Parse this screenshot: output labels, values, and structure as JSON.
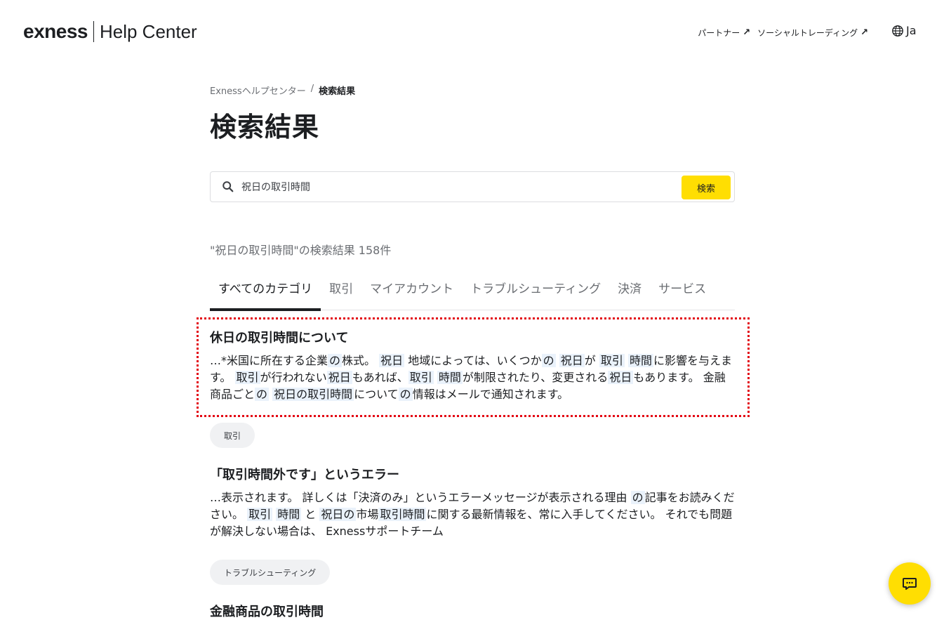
{
  "header": {
    "logo_text": "exness",
    "logo_subtitle": "Help Center",
    "links": [
      {
        "label": "パートナー",
        "icon": "external-arrow-icon"
      },
      {
        "label": "ソーシャルトレーディング",
        "icon": "external-arrow-icon"
      }
    ],
    "language": "Ja"
  },
  "breadcrumb": {
    "home": "Exnessヘルプセンター",
    "separator": "/",
    "current": "検索結果"
  },
  "page_title": "検索結果",
  "search": {
    "value": "祝日の取引時間",
    "button_label": "検索"
  },
  "results_count": "\"祝日の取引時間\"の検索結果 158件",
  "tabs": [
    {
      "label": "すべてのカテゴリ",
      "active": true
    },
    {
      "label": "取引"
    },
    {
      "label": "マイアカウント"
    },
    {
      "label": "トラブルシューティング"
    },
    {
      "label": "決済"
    },
    {
      "label": "サービス"
    }
  ],
  "results": [
    {
      "title": "休日の取引時間について",
      "category": "取引"
    },
    {
      "title": "「取引時間外です」というエラー",
      "category": "トラブルシューティング"
    },
    {
      "title": "金融商品の取引時間"
    }
  ],
  "colors": {
    "accent": "#ffde02",
    "highlight_bg": "#eaf2fb",
    "annotation_border": "#e30613"
  }
}
